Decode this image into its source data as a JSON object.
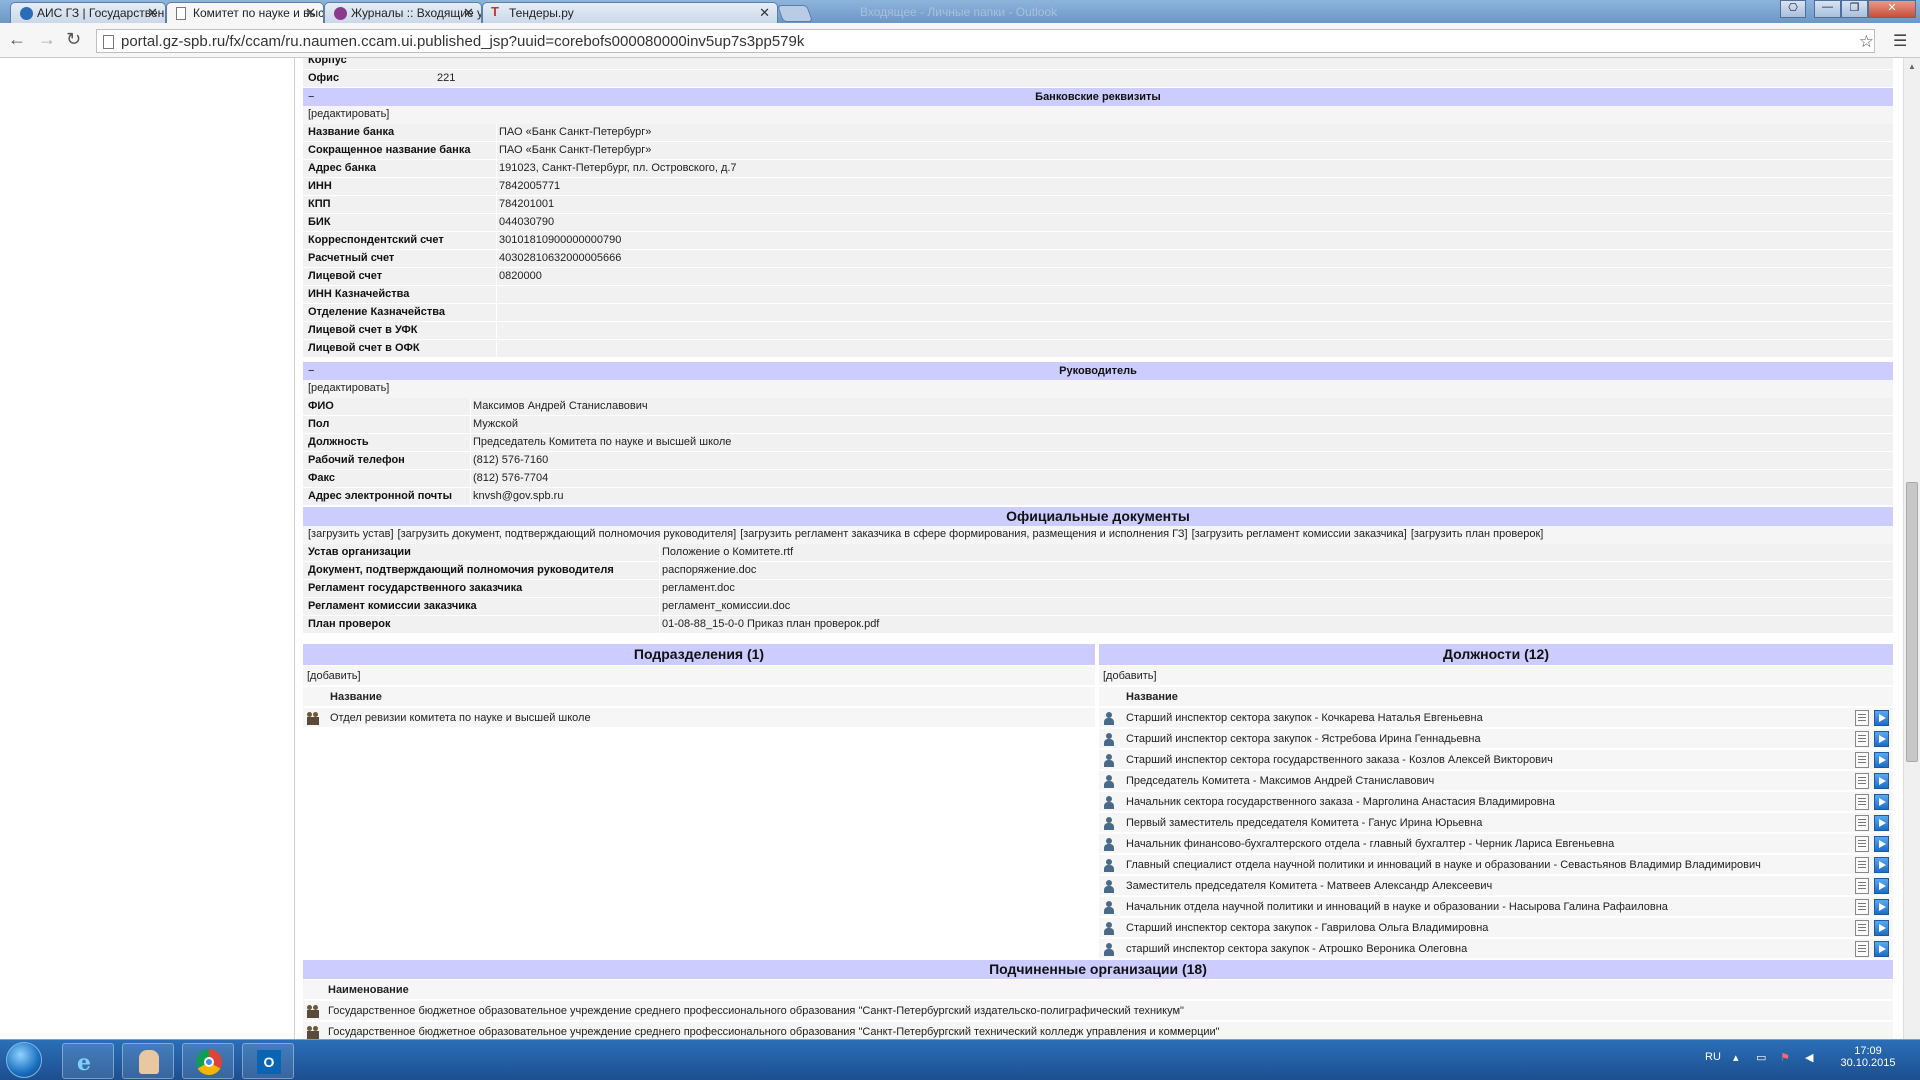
{
  "browser": {
    "tabs": [
      {
        "label": "АИС ГЗ | Государственны",
        "icon": "ais-logo-icon"
      },
      {
        "label": "Комитет по науке и высш",
        "icon": "page-icon"
      },
      {
        "label": "Журналы :: Входящие уве",
        "icon": "journal-icon"
      },
      {
        "label": "Тендеры.ру",
        "icon": "tenders-icon"
      }
    ],
    "faded_title": "Входящее - Личные папки - Outlook",
    "url": "portal.gz-spb.ru/fx/ccam/ru.naumen.ccam.ui.published_jsp?uuid=corebofs000080000inv5up7s3pp579k",
    "url_domain": "portal.gz-spb.ru"
  },
  "top": {
    "partial_label": "Корпус",
    "office_label": "Офис",
    "office_value": "221"
  },
  "bank": {
    "title": "Банковские реквизиты",
    "edit": "[редактировать]",
    "rows": [
      {
        "label": "Название банка",
        "value": "ПАО «Банк Санкт-Петербург»"
      },
      {
        "label": "Сокращенное название банка",
        "value": "ПАО «Банк Санкт-Петербург»"
      },
      {
        "label": "Адрес банка",
        "value": "191023, Санкт-Петербург, пл. Островского, д.7"
      },
      {
        "label": "ИНН",
        "value": "7842005771"
      },
      {
        "label": "КПП",
        "value": "784201001"
      },
      {
        "label": "БИК",
        "value": "044030790"
      },
      {
        "label": "Корреспондентский счет",
        "value": "30101810900000000790"
      },
      {
        "label": "Расчетный счет",
        "value": "40302810632000005666"
      },
      {
        "label": "Лицевой счет",
        "value": "0820000"
      },
      {
        "label": "ИНН Казначейства",
        "value": ""
      },
      {
        "label": "Отделение Казначейства",
        "value": ""
      },
      {
        "label": "Лицевой счет в УФК",
        "value": ""
      },
      {
        "label": "Лицевой счет в ОФК",
        "value": ""
      }
    ]
  },
  "head": {
    "title": "Руководитель",
    "edit": "[редактировать]",
    "rows": [
      {
        "label": "ФИО",
        "value": "Максимов Андрей Станиславович"
      },
      {
        "label": "Пол",
        "value": "Мужской"
      },
      {
        "label": "Должность",
        "value": "Председатель Комитета по науке и высшей школе"
      },
      {
        "label": "Рабочий телефон",
        "value": "(812) 576-7160"
      },
      {
        "label": "Факс",
        "value": "(812) 576-7704"
      },
      {
        "label": "Адрес электронной почты",
        "value": "knvsh@gov.spb.ru"
      }
    ]
  },
  "docs": {
    "title": "Официальные документы",
    "links": [
      "[загрузить устав]",
      "[загрузить документ, подтверждающий полномочия руководителя]",
      "[загрузить регламент заказчика в сфере формирования, размещения и исполнения ГЗ]",
      "[загрузить регламент комиссии заказчика]",
      "[загрузить план проверок]"
    ],
    "rows": [
      {
        "label": "Устав организации",
        "value": "Положение о Комитете.rtf"
      },
      {
        "label": "Документ, подтверждающий полномочия руководителя",
        "value": "распоряжение.doc"
      },
      {
        "label": "Регламент государственного заказчика",
        "value": "регламент.doc"
      },
      {
        "label": "Регламент комиссии заказчика",
        "value": "регламент_комиссии.doc"
      },
      {
        "label": "План проверок",
        "value": "01-08-88_15-0-0 Приказ план проверок.pdf"
      }
    ]
  },
  "divisions": {
    "title": "Подразделения (1)",
    "add": "[добавить]",
    "col_header": "Название",
    "items": [
      "Отдел ревизии комитета по науке и высшей школе"
    ]
  },
  "positions": {
    "title": "Должности (12)",
    "add": "[добавить]",
    "col_header": "Название",
    "items": [
      "Старший инспектор сектора закупок - Кочкарева Наталья Евгеньевна",
      "Старший инспектор сектора закупок - Ястребова Ирина Геннадьевна",
      "Старший инспектор сектора государственного заказа - Козлов Алексей Викторович",
      "Председатель Комитета - Максимов Андрей Станиславович",
      "Начальник сектора государственного заказа - Марголина Анастасия Владимировна",
      "Первый заместитель председателя Комитета - Ганус Ирина Юрьевна",
      "Начальник финансово-бухгалтерского отдела - главный бухгалтер - Черник Лариса Евгеньевна",
      "Главный специалист отдела научной политики и инноваций в науке и образовании - Севастьянов Владимир Владимирович",
      "Заместитель председателя Комитета - Матвеев Александр Алексеевич",
      "Начальник отдела научной политики и инноваций в науке и образовании - Насырова Галина Рафаиловна",
      "Старший инспектор сектора закупок - Гаврилова Ольга Владимировна",
      "старший инспектор сектора закупок - Атрошко Вероника Олеговна"
    ]
  },
  "subordinates": {
    "title": "Подчиненные организации (18)",
    "col_header": "Наименование",
    "items": [
      "Государственное бюджетное образовательное учреждение среднего профессионального образования \"Санкт-Петербургский издательско-полиграфический техникум\"",
      "Государственное бюджетное образовательное учреждение среднего профессионального образования \"Санкт-Петербургский технический колледж управления и коммерции\""
    ]
  },
  "taskbar": {
    "lang": "RU",
    "time": "17:09",
    "date": "30.10.2015"
  },
  "colors": {
    "section_bg": "#ccccff",
    "row_bg": "#f1f1f1",
    "taskbar": "#1d4f8f"
  }
}
